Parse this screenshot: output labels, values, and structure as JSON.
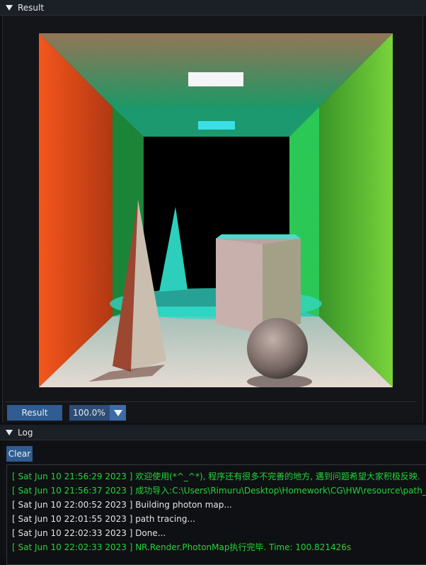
{
  "result_panel": {
    "title": "Result"
  },
  "toolbar": {
    "result_label": "Result",
    "zoom_value": "100.0%"
  },
  "log_panel": {
    "title": "Log",
    "clear_label": "Clear",
    "entries": [
      {
        "text": "[ Sat Jun 10 21:56:29 2023 ] 欢迎使用(*^_^*), 程序还有很多不完善的地方, 遇到问题希望大家积极反映.",
        "color": "#22d43a"
      },
      {
        "text": "[ Sat Jun 10 21:56:37 2023 ] 成功导入:C:\\Users\\Rimuru\\Desktop\\Homework\\CG\\HW\\resource\\path_tra",
        "color": "#22d43a"
      },
      {
        "text": "[ Sat Jun 10 22:00:52 2023 ] Building photon map...",
        "color": "#e4e4e4"
      },
      {
        "text": "[ Sat Jun 10 22:01:55 2023 ] path tracing...",
        "color": "#e4e4e4"
      },
      {
        "text": "[ Sat Jun 10 22:02:33 2023 ] Done...",
        "color": "#e4e4e4"
      },
      {
        "text": "[ Sat Jun 10 22:02:33 2023 ] NR.Render.PhotonMap执行完毕. Time: 100.821426s",
        "color": "#22d43a"
      }
    ]
  },
  "icons": {
    "result_collapse": "triangle-down-icon",
    "log_collapse": "triangle-down-icon",
    "zoom_dropdown": "chevron-down-icon"
  }
}
